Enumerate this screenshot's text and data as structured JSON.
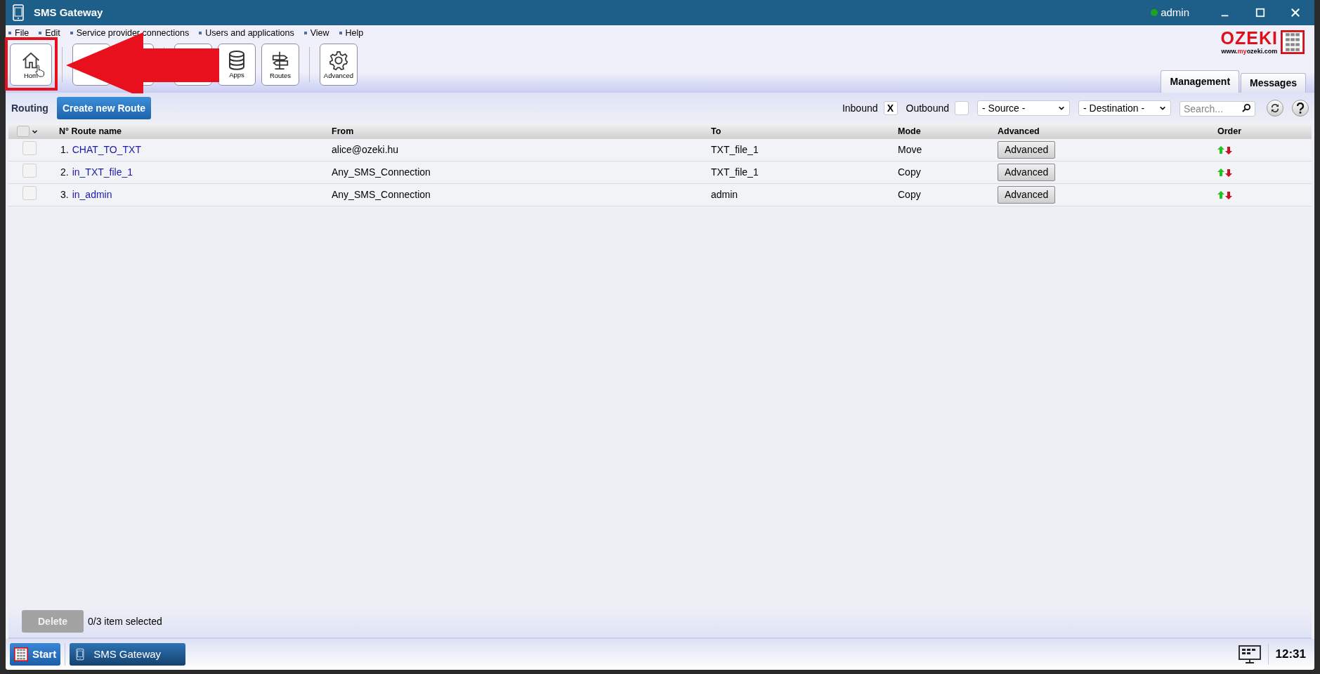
{
  "window": {
    "title": "SMS Gateway"
  },
  "user": {
    "name": "admin",
    "online": true
  },
  "menu": [
    "File",
    "Edit",
    "Service provider connections",
    "Users and applications",
    "View",
    "Help"
  ],
  "toolbar": [
    {
      "kind": "home",
      "label": "Hom"
    },
    {
      "kind": "blank"
    },
    {
      "kind": "blank"
    },
    {
      "kind": "blank"
    },
    {
      "kind": "apps",
      "label": "Apps"
    },
    {
      "kind": "routes",
      "label": "Routes"
    },
    {
      "kind": "gear",
      "label": "Advanced"
    }
  ],
  "logo": {
    "brand": "OZEKI",
    "url_start": "www.",
    "url_mid": "my",
    "url_end": "ozeki.com"
  },
  "tabs": [
    {
      "label": "Management",
      "selected": true
    },
    {
      "label": "Messages",
      "selected": false
    }
  ],
  "routing": {
    "title": "Routing",
    "create_button": "Create new Route"
  },
  "filters": {
    "inbound": {
      "label": "Inbound",
      "checked": true,
      "mark": "X"
    },
    "outbound": {
      "label": "Outbound",
      "checked": false
    },
    "source": "- Source -",
    "destination": "- Destination -",
    "search_placeholder": "Search..."
  },
  "select_all": {
    "checked": false
  },
  "table": {
    "columns": [
      "N° Route name",
      "From",
      "To",
      "Mode",
      "Advanced",
      "Order"
    ],
    "rows": [
      {
        "number": "1.",
        "name": "CHAT_TO_TXT",
        "from": "alice@ozeki.hu",
        "to": "TXT_file_1",
        "mode": "Move",
        "advanced": "Advanced",
        "selected": false
      },
      {
        "number": "2.",
        "name": "in_TXT_file_1",
        "from": "Any_SMS_Connection",
        "to": "TXT_file_1",
        "mode": "Copy",
        "advanced": "Advanced",
        "selected": false
      },
      {
        "number": "3.",
        "name": "in_admin",
        "from": "Any_SMS_Connection",
        "to": "admin",
        "mode": "Copy",
        "advanced": "Advanced",
        "selected": false
      }
    ]
  },
  "footer": {
    "delete_button": "Delete",
    "delete_disabled": true,
    "selection": "0/3 item selected"
  },
  "taskbar": {
    "start": "Start",
    "app": "SMS Gateway",
    "clock": "12:31"
  },
  "annotations": {
    "highlight_frame": true,
    "pointer_arrow": true
  }
}
